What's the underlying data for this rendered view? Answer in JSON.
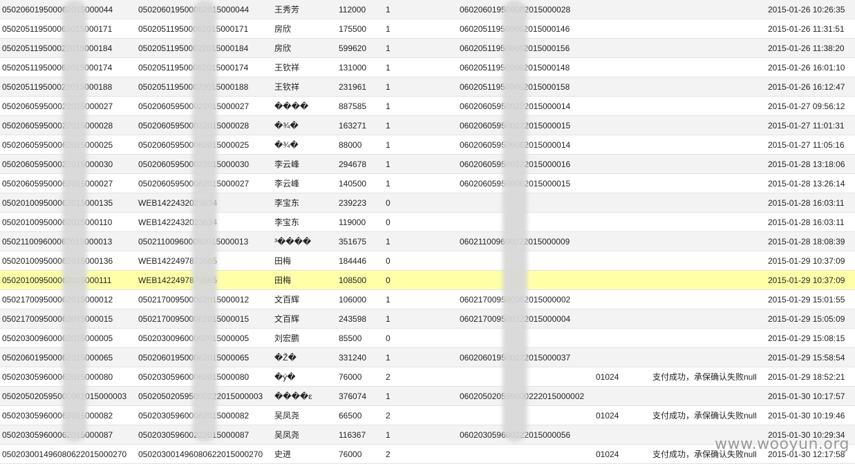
{
  "rows": [
    {
      "c1": "050206019500062015000044",
      "c2": "050206019500062015000044",
      "name": "王秀芳",
      "amount": "112000",
      "flag": "1",
      "ref": "060206019500062015000028",
      "code": "",
      "msg": "",
      "time": "2015-01-26 10:26:35"
    },
    {
      "c1": "050205119500062015000171",
      "c2": "050205119500062015000171",
      "name": "房欣",
      "amount": "175500",
      "flag": "1",
      "ref": "060205119500062015000146",
      "code": "",
      "msg": "",
      "time": "2015-01-26 11:31:51"
    },
    {
      "c1": "050205119500022015000184",
      "c2": "050205119500022015000184",
      "name": "房欣",
      "amount": "599620",
      "flag": "1",
      "ref": "060205119500062015000156",
      "code": "",
      "msg": "",
      "time": "2015-01-26 11:38:20"
    },
    {
      "c1": "050205119500062015000174",
      "c2": "050205119500062015000174",
      "name": "王钦祥",
      "amount": "131000",
      "flag": "1",
      "ref": "060205119500062015000148",
      "code": "",
      "msg": "",
      "time": "2015-01-26 16:01:10"
    },
    {
      "c1": "050205119500022015000188",
      "c2": "050205119500022015000188",
      "name": "王钦祥",
      "amount": "231961",
      "flag": "1",
      "ref": "060205119500062015000158",
      "code": "",
      "msg": "",
      "time": "2015-01-26 16:12:47"
    },
    {
      "c1": "050206059500022015000027",
      "c2": "050206059500022015000027",
      "name": "����",
      "amount": "887585",
      "flag": "1",
      "ref": "060206059500222015000014",
      "code": "",
      "msg": "",
      "time": "2015-01-27 09:56:12"
    },
    {
      "c1": "050206059500022015000028",
      "c2": "050206059500022015000028",
      "name": "�¾�",
      "amount": "163271",
      "flag": "1",
      "ref": "060206059500222015000015",
      "code": "",
      "msg": "",
      "time": "2015-01-27 11:01:31"
    },
    {
      "c1": "050206059500062015000025",
      "c2": "050206059500062015000025",
      "name": "�¾�",
      "amount": "88000",
      "flag": "1",
      "ref": "060206059500062015000014",
      "code": "",
      "msg": "",
      "time": "2015-01-27 11:05:16"
    },
    {
      "c1": "050206059500022015000030",
      "c2": "050206059500022015000030",
      "name": "李云峰",
      "amount": "294678",
      "flag": "1",
      "ref": "060206059500222015000016",
      "code": "",
      "msg": "",
      "time": "2015-01-28 13:18:06"
    },
    {
      "c1": "050206059500062015000027",
      "c2": "050206059500062015000027",
      "name": "李云峰",
      "amount": "140500",
      "flag": "1",
      "ref": "060206059500062015000015",
      "code": "",
      "msg": "",
      "time": "2015-01-28 13:26:14"
    },
    {
      "c1": "050201009500062015000135",
      "c2": "WEB1422432023634",
      "name": "李宝东",
      "amount": "239223",
      "flag": "0",
      "ref": "",
      "code": "",
      "msg": "",
      "time": "2015-01-28 16:03:11"
    },
    {
      "c1": "050201009500062015000110",
      "c2": "WEB1422432023634",
      "name": "李宝东",
      "amount": "119000",
      "flag": "0",
      "ref": "",
      "code": "",
      "msg": "",
      "time": "2015-01-28 16:03:11"
    },
    {
      "c1": "050211009600062015000013",
      "c2": "050211009600062015000013",
      "name": "³����",
      "amount": "351675",
      "flag": "1",
      "ref": "060211009600222015000009",
      "code": "",
      "msg": "",
      "time": "2015-01-28 18:08:39"
    },
    {
      "c1": "050201009500062015000136",
      "c2": "WEB1422497873565",
      "name": "田梅",
      "amount": "184446",
      "flag": "0",
      "ref": "",
      "code": "",
      "msg": "",
      "time": "2015-01-29 10:37:09"
    },
    {
      "c1": "050201009500062015000111",
      "c2": "WEB1422497873565",
      "name": "田梅",
      "amount": "108500",
      "flag": "0",
      "ref": "",
      "code": "",
      "msg": "",
      "time": "2015-01-29 10:37:09"
    },
    {
      "c1": "050217009500062015000012",
      "c2": "050217009500062015000012",
      "name": "文百辉",
      "amount": "106000",
      "flag": "1",
      "ref": "060217009500062015000002",
      "code": "",
      "msg": "",
      "time": "2015-01-29 15:01:55"
    },
    {
      "c1": "050217009500062015000015",
      "c2": "050217009500062015000015",
      "name": "文百辉",
      "amount": "243598",
      "flag": "1",
      "ref": "060217009500222015000004",
      "code": "",
      "msg": "",
      "time": "2015-01-29 15:05:09"
    },
    {
      "c1": "050203009600062015000005",
      "c2": "050203009600062015000005",
      "name": "刘宏鹏",
      "amount": "85500",
      "flag": "0",
      "ref": "",
      "code": "",
      "msg": "",
      "time": "2015-01-29 15:08:15"
    },
    {
      "c1": "050206019500062015000065",
      "c2": "050206019500062015000065",
      "name": "�Ž�",
      "amount": "331240",
      "flag": "1",
      "ref": "060206019500222015000037",
      "code": "",
      "msg": "",
      "time": "2015-01-29 15:58:54"
    },
    {
      "c1": "050203059600062015000080",
      "c2": "050203059600062015000080",
      "name": "�ý�",
      "amount": "76000",
      "flag": "2",
      "ref": "",
      "code": "01024",
      "msg": "支付成功，承保确认失败null",
      "time": "2015-01-29 18:52:21"
    },
    {
      "c1": "050205020595000062015000003",
      "c2": "050205020595000222015000003",
      "name": "����ε",
      "amount": "376074",
      "flag": "1",
      "ref": "060205020595000222015000002",
      "code": "",
      "msg": "",
      "time": "2015-01-30 10:17:57"
    },
    {
      "c1": "050203059600062015000082",
      "c2": "050203059600062015000082",
      "name": "吴凤尧",
      "amount": "66500",
      "flag": "2",
      "ref": "",
      "code": "01024",
      "msg": "支付成功，承保确认失败null",
      "time": "2015-01-30 10:19:46"
    },
    {
      "c1": "050203059600062015000087",
      "c2": "050203059600222015000087",
      "name": "吴凤尧",
      "amount": "116367",
      "flag": "1",
      "ref": "060203059600222015000056",
      "code": "",
      "msg": "",
      "time": "2015-01-30 10:29:34"
    },
    {
      "c1": "050203001496080622015000270",
      "c2": "050203001496080622015000270",
      "name": "史进",
      "amount": "76000",
      "flag": "2",
      "ref": "",
      "code": "01024",
      "msg": "支付成功，承保确认失败null",
      "time": "2015-01-30 12:17:58"
    }
  ],
  "selected_row": 14,
  "watermark": "www.wooyun.org",
  "colors": {
    "selected_row": "#ffffa8",
    "odd_row": "#f3f3f3",
    "even_row": "#ffffff"
  }
}
